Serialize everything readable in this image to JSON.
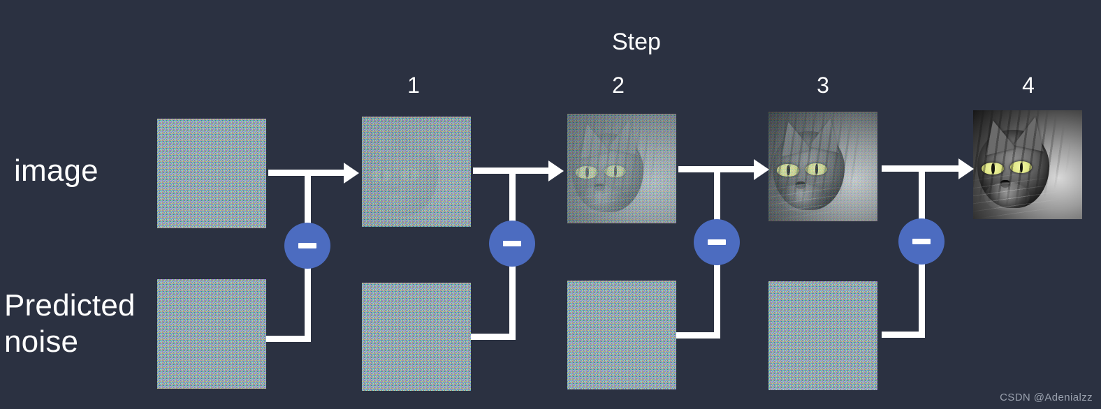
{
  "diagram": {
    "title": "Step",
    "background_color": "#2b3141",
    "accent_color": "#4c6cc0",
    "line_color": "#ffffff",
    "text_color": "#ffffff"
  },
  "row_labels": {
    "top": "image",
    "bottom": "Predicted\nnoise"
  },
  "steps": [
    {
      "number": "1"
    },
    {
      "number": "2"
    },
    {
      "number": "3"
    },
    {
      "number": "4"
    }
  ],
  "image_row": [
    {
      "caption": "",
      "kind": "pure-noise"
    },
    {
      "caption": "1",
      "kind": "noisy-cat-heavy"
    },
    {
      "caption": "2",
      "kind": "noisy-cat-medium"
    },
    {
      "caption": "3",
      "kind": "noisy-cat-light"
    },
    {
      "caption": "4",
      "kind": "clean-cat"
    }
  ],
  "noise_row": [
    {
      "kind": "pure-noise"
    },
    {
      "kind": "pure-noise"
    },
    {
      "kind": "pure-noise"
    },
    {
      "kind": "pure-noise"
    }
  ],
  "operators": [
    {
      "symbol": "−",
      "name": "subtract"
    },
    {
      "symbol": "−",
      "name": "subtract"
    },
    {
      "symbol": "−",
      "name": "subtract"
    },
    {
      "symbol": "−",
      "name": "subtract"
    }
  ],
  "watermark": "CSDN @Adenialzz"
}
